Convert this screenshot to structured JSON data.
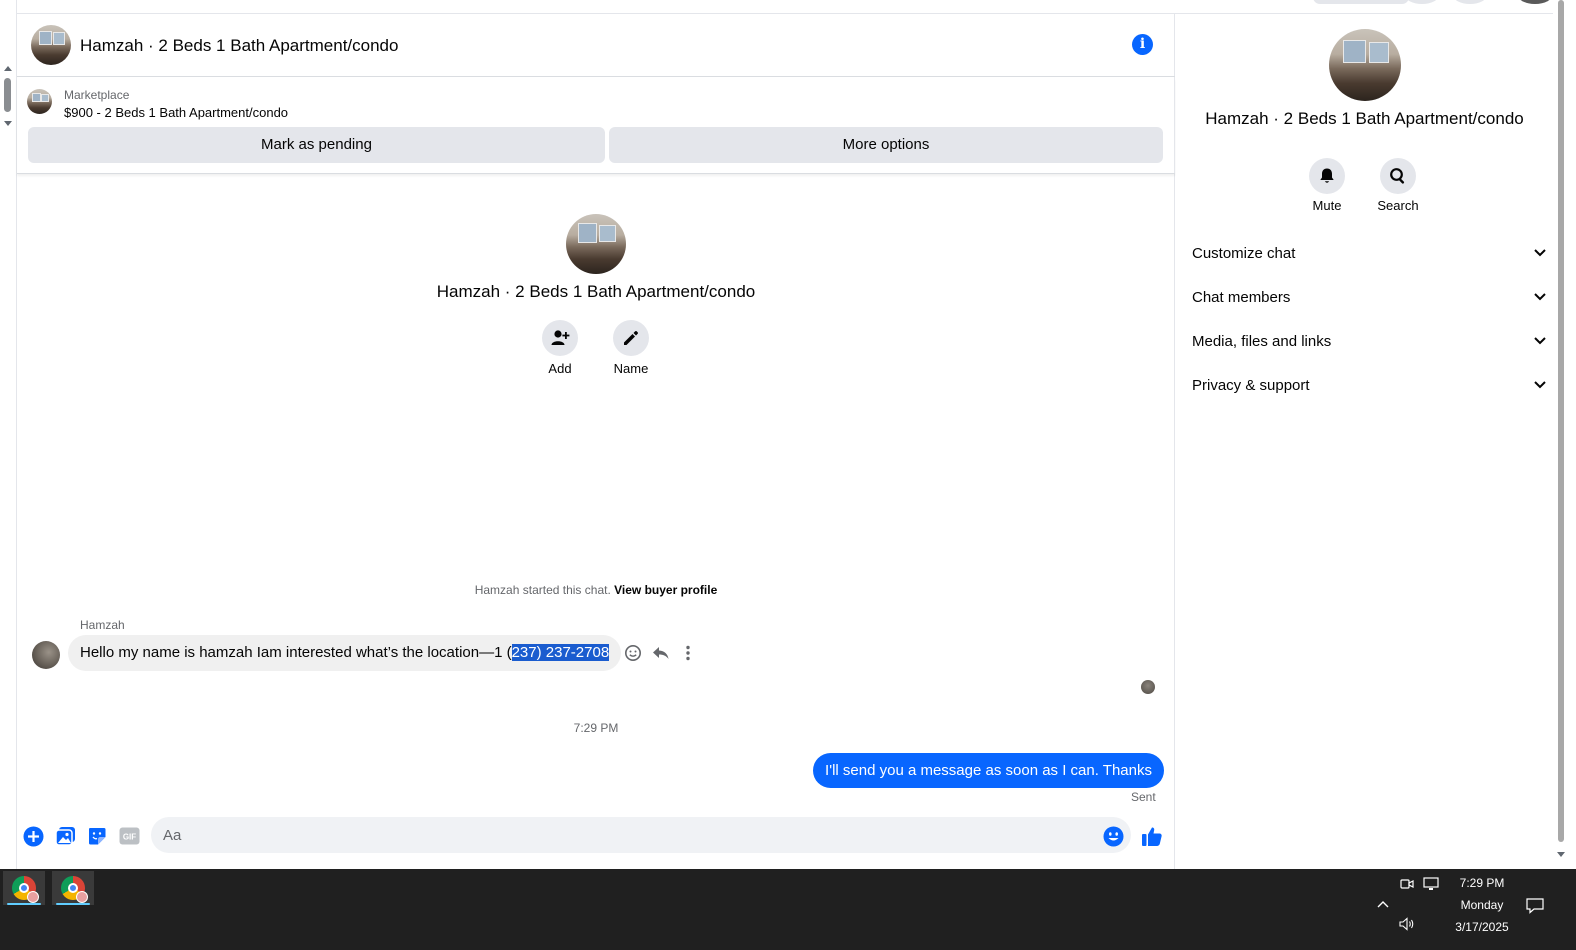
{
  "chat": {
    "header_title": "Hamzah · 2 Beds 1 Bath Apartment/condo",
    "marketplace": {
      "label": "Marketplace",
      "listing": "$900 - 2 Beds 1 Bath Apartment/condo",
      "mark_pending_label": "Mark as pending",
      "more_options_label": "More options"
    },
    "intro": {
      "title": "Hamzah · 2 Beds 1 Bath Apartment/condo",
      "add_label": "Add",
      "name_label": "Name"
    },
    "started_text": "Hamzah started this chat.",
    "view_buyer_profile": "View buyer profile",
    "incoming": {
      "sender": "Hamzah",
      "text_before": "Hello my name is hamzah Iam interested what’s the location—1 (",
      "text_selected": "237) 237-2708"
    },
    "timestamp": "7:29 PM",
    "outgoing": {
      "text": "I'll send you a message as soon as I can. Thanks",
      "status": "Sent"
    },
    "composer": {
      "placeholder": "Aa",
      "gif_label": "GIF"
    }
  },
  "right_panel": {
    "title": "Hamzah · 2 Beds 1 Bath Apartment/condo",
    "mute_label": "Mute",
    "search_label": "Search",
    "sections": [
      "Customize chat",
      "Chat members",
      "Media, files and links",
      "Privacy & support"
    ]
  },
  "taskbar": {
    "time": "7:29 PM",
    "day": "Monday",
    "date": "3/17/2025"
  },
  "colors": {
    "accent": "#0866ff",
    "selection": "#1a5ccf",
    "taskbar": "#202020"
  },
  "icons": [
    "info-icon",
    "person-add-icon",
    "pencil-icon",
    "smile-icon",
    "reply-icon",
    "more-vertical-icon",
    "plus-circle-icon",
    "photo-icon",
    "sticker-icon",
    "gif-icon",
    "emoji-icon",
    "thumbs-up-icon",
    "bell-icon",
    "search-icon",
    "chevron-down-icon",
    "chrome-icon",
    "notification-icon",
    "speaker-icon",
    "network-icon",
    "meet-icon"
  ]
}
